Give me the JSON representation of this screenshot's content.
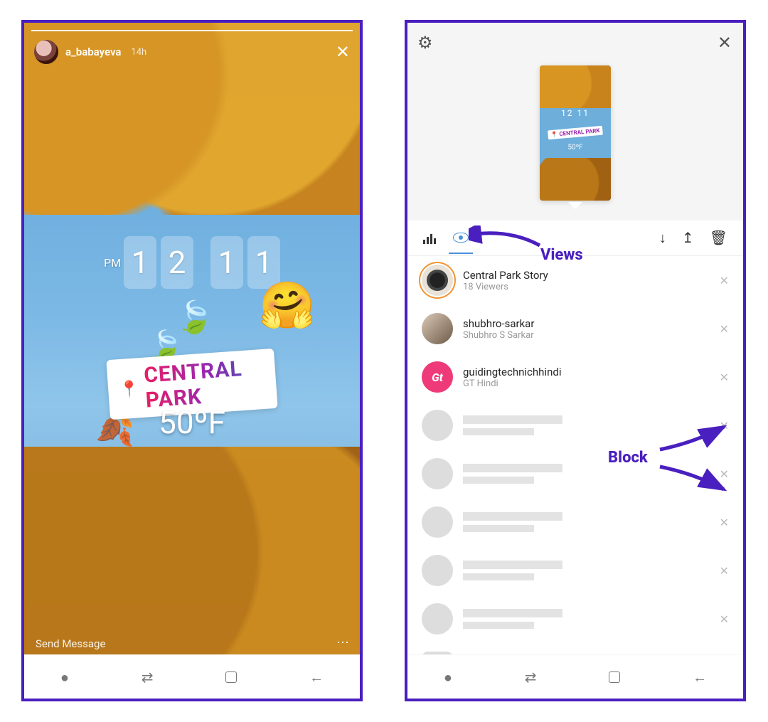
{
  "left": {
    "username": "a_babayeva",
    "timestamp": "14h",
    "clock": {
      "pm": "PM",
      "h1": "1",
      "h2": "2",
      "m1": "1",
      "m2": "1"
    },
    "location_pin": "📍",
    "location_text": "CENTRAL PARK",
    "temperature": "50ºF",
    "emoji_hug": "🤗",
    "leaf1": "🍃",
    "leaf2": "🍃",
    "leaf3": "🍂",
    "send_message": "Send Message",
    "more": "⋯",
    "close": "✕"
  },
  "right": {
    "gear": "⚙",
    "close": "✕",
    "thumb": {
      "time": "12 11",
      "chip": "📍 CENTRAL PARK",
      "temp": "50ºF"
    },
    "toolbar": {
      "download": "↓",
      "share": "↥",
      "delete": "🗑"
    },
    "viewers": [
      {
        "title": "Central Park Story",
        "sub": "18 Viewers",
        "type": "story"
      },
      {
        "title": "shubhro-sarkar",
        "sub": "Shubhro S Sarkar",
        "type": "user1"
      },
      {
        "title": "guidingtechnichhindi",
        "sub": "GT Hindi",
        "type": "gt"
      }
    ],
    "gt_logo": "Gt",
    "row_close": "✕"
  },
  "annotations": {
    "views": "Views",
    "block": "Block"
  }
}
